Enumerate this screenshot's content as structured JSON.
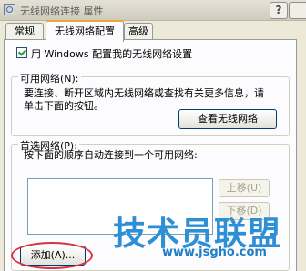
{
  "window": {
    "title": "无线网络连接 属性",
    "help_label": "?"
  },
  "tabs": [
    {
      "label": "常规"
    },
    {
      "label": "无线网络配置"
    },
    {
      "label": "高级"
    }
  ],
  "use_windows_checkbox": {
    "label": "用 Windows 配置我的无线网络设置",
    "checked": true
  },
  "available_networks": {
    "title": "可用网络(N):",
    "description_line1": "要连接、断开区域内无线网络或查找有关更多信息，请",
    "description_line2": "单击下面的按钮。",
    "view_button": "查看无线网络"
  },
  "preferred_networks": {
    "title": "首选网络(P):",
    "description": "按下面的顺序自动连接到一个可用网络:",
    "move_up_button": "上移(U)",
    "move_down_button": "下移(D)",
    "add_button": "添加(A)..."
  },
  "watermark": {
    "title": "技术员联盟",
    "url": "www.jsgho.com"
  },
  "colors": {
    "accent_tab": "#f2a43a",
    "highlight": "#d9333f",
    "watermark": "#2d8fd5"
  }
}
